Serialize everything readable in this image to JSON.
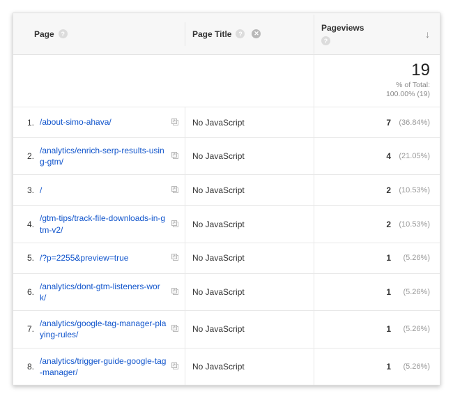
{
  "header": {
    "page_col": "Page",
    "title_col": "Page Title",
    "views_col": "Pageviews"
  },
  "summary": {
    "total": "19",
    "sub1": "% of Total:",
    "sub2": "100.00% (19)"
  },
  "rows": [
    {
      "num": "1.",
      "page": "/about-simo-ahava/",
      "title": "No JavaScript",
      "count": "7",
      "pct": "(36.84%)"
    },
    {
      "num": "2.",
      "page": "/analytics/enrich-serp-results-using-gtm/",
      "title": "No JavaScript",
      "count": "4",
      "pct": "(21.05%)"
    },
    {
      "num": "3.",
      "page": "/",
      "title": "No JavaScript",
      "count": "2",
      "pct": "(10.53%)"
    },
    {
      "num": "4.",
      "page": "/gtm-tips/track-file-downloads-in-gtm-v2/",
      "title": "No JavaScript",
      "count": "2",
      "pct": "(10.53%)"
    },
    {
      "num": "5.",
      "page": "/?p=2255&preview=true",
      "title": "No JavaScript",
      "count": "1",
      "pct": "(5.26%)"
    },
    {
      "num": "6.",
      "page": "/analytics/dont-gtm-listeners-work/",
      "title": "No JavaScript",
      "count": "1",
      "pct": "(5.26%)"
    },
    {
      "num": "7.",
      "page": "/analytics/google-tag-manager-playing-rules/",
      "title": "No JavaScript",
      "count": "1",
      "pct": "(5.26%)"
    },
    {
      "num": "8.",
      "page": "/analytics/trigger-guide-google-tag-manager/",
      "title": "No JavaScript",
      "count": "1",
      "pct": "(5.26%)"
    }
  ]
}
